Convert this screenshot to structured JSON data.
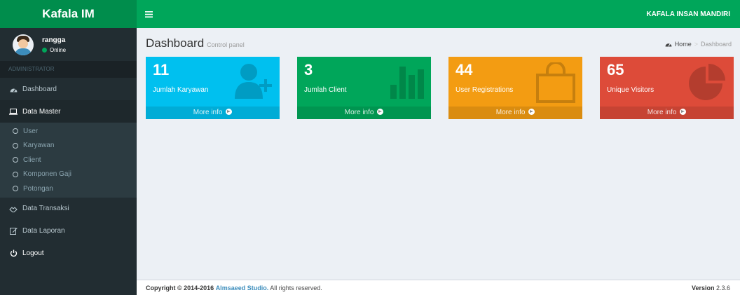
{
  "header": {
    "logo": "Kafala IM",
    "toggle_icon": "bars-icon",
    "company": "KAFALA INSAN MANDIRI"
  },
  "user": {
    "name": "rangga",
    "status": "Online"
  },
  "sidebar": {
    "section": "ADMINISTRATOR",
    "items": [
      {
        "label": "Dashboard",
        "icon": "dashboard-icon"
      },
      {
        "label": "Data Master",
        "icon": "laptop-icon"
      },
      {
        "label": "Data Transaksi",
        "icon": "handshake-icon"
      },
      {
        "label": "Data Laporan",
        "icon": "edit-icon"
      },
      {
        "label": "Logout",
        "icon": "power-icon"
      }
    ],
    "submenu": [
      {
        "label": "User"
      },
      {
        "label": "Karyawan"
      },
      {
        "label": "Client"
      },
      {
        "label": "Komponen Gaji"
      },
      {
        "label": "Potongan"
      }
    ]
  },
  "content": {
    "title": "Dashboard",
    "subtitle": "Control panel",
    "breadcrumb_home": "Home",
    "breadcrumb_current": "Dashboard"
  },
  "boxes": [
    {
      "value": "11",
      "label": "Jumlah Karyawan",
      "footer": "More info",
      "color": "#00c0ef",
      "icon": "user-plus-icon"
    },
    {
      "value": "3",
      "label": "Jumlah Client",
      "footer": "More info",
      "color": "#00a65a",
      "icon": "bar-chart-icon"
    },
    {
      "value": "44",
      "label": "User Registrations",
      "footer": "More info",
      "color": "#f39c12",
      "icon": "shopping-bag-icon"
    },
    {
      "value": "65",
      "label": "Unique Visitors",
      "footer": "More info",
      "color": "#dd4b39",
      "icon": "pie-chart-icon"
    }
  ],
  "footer": {
    "copyright_prefix": "Copyright © 2014-2016",
    "company_link": "Almsaeed Studio.",
    "rights": "All rights reserved.",
    "version_label": "Version",
    "version_number": "2.3.6"
  }
}
